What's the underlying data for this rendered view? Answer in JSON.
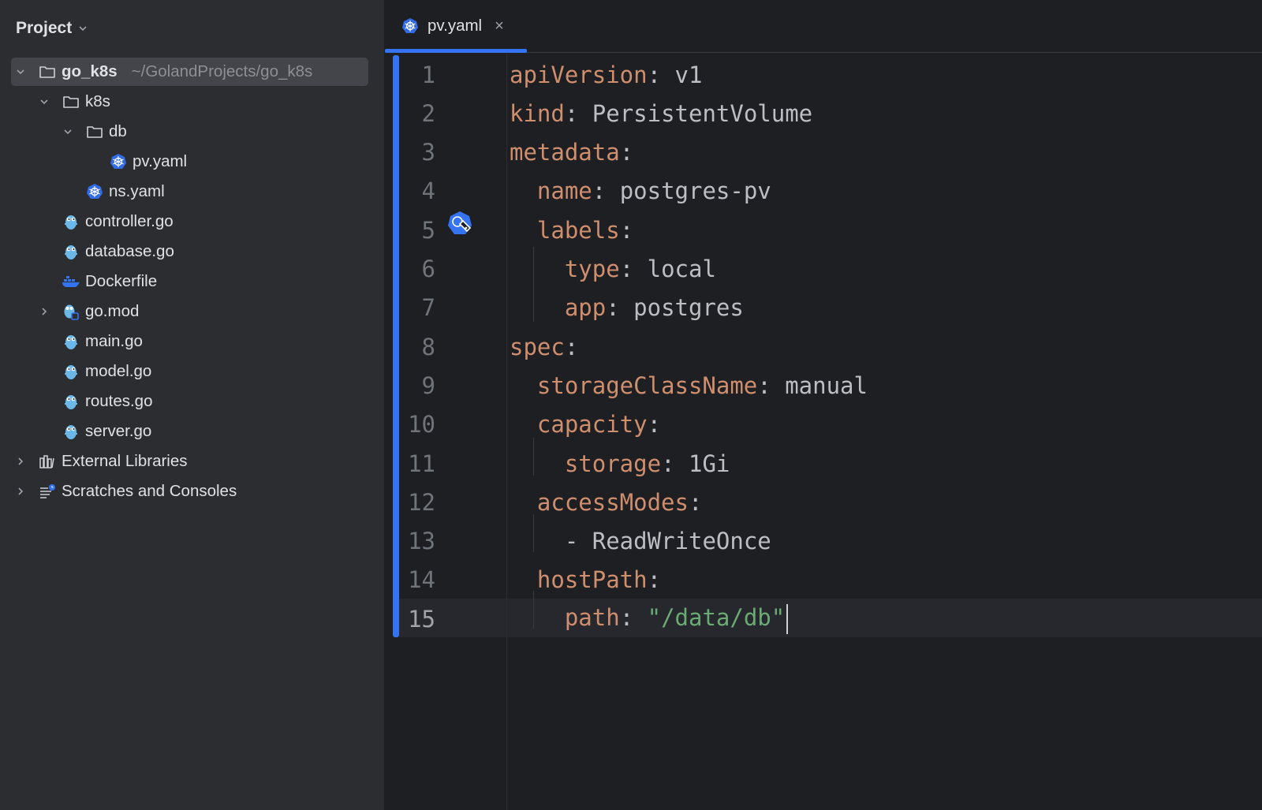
{
  "sidebar": {
    "title": "Project",
    "tree": [
      {
        "label": "go_k8s",
        "path": "~/GolandProjects/go_k8s",
        "icon": "folder-icon"
      },
      {
        "label": "k8s",
        "icon": "folder-icon"
      },
      {
        "label": "db",
        "icon": "folder-icon"
      },
      {
        "label": "pv.yaml",
        "icon": "kubernetes-icon"
      },
      {
        "label": "ns.yaml",
        "icon": "kubernetes-icon"
      },
      {
        "label": "controller.go",
        "icon": "gopher-icon"
      },
      {
        "label": "database.go",
        "icon": "gopher-icon"
      },
      {
        "label": "Dockerfile",
        "icon": "docker-icon"
      },
      {
        "label": "go.mod",
        "icon": "gomod-icon"
      },
      {
        "label": "main.go",
        "icon": "gopher-icon"
      },
      {
        "label": "model.go",
        "icon": "gopher-icon"
      },
      {
        "label": "routes.go",
        "icon": "gopher-icon"
      },
      {
        "label": "server.go",
        "icon": "gopher-icon"
      },
      {
        "label": "External Libraries",
        "icon": "libraries-icon"
      },
      {
        "label": "Scratches and Consoles",
        "icon": "scratches-icon"
      }
    ]
  },
  "editor": {
    "tab": {
      "label": "pv.yaml",
      "close": "×"
    },
    "lines": [
      {
        "n": "1",
        "key": "apiVersion",
        "colon": ":",
        "val": " v1"
      },
      {
        "n": "2",
        "key": "kind",
        "colon": ":",
        "val": " PersistentVolume"
      },
      {
        "n": "3",
        "key": "metadata",
        "colon": ":",
        "val": ""
      },
      {
        "n": "4",
        "key": "  name",
        "colon": ":",
        "val": " postgres-pv"
      },
      {
        "n": "5",
        "key": "  labels",
        "colon": ":",
        "val": ""
      },
      {
        "n": "6",
        "key": "    type",
        "colon": ":",
        "val": " local"
      },
      {
        "n": "7",
        "key": "    app",
        "colon": ":",
        "val": " postgres"
      },
      {
        "n": "8",
        "key": "spec",
        "colon": ":",
        "val": ""
      },
      {
        "n": "9",
        "key": "  storageClassName",
        "colon": ":",
        "val": " manual"
      },
      {
        "n": "10",
        "key": "  capacity",
        "colon": ":",
        "val": ""
      },
      {
        "n": "11",
        "key": "    storage",
        "colon": ":",
        "val": " 1Gi"
      },
      {
        "n": "12",
        "key": "  accessModes",
        "colon": ":",
        "val": ""
      },
      {
        "n": "13",
        "key": "    ",
        "colon": "- ",
        "val": "ReadWriteOnce"
      },
      {
        "n": "14",
        "key": "  hostPath",
        "colon": ":",
        "val": ""
      },
      {
        "n": "15",
        "key": "    path",
        "colon": ": ",
        "val": "\"/data/db\""
      }
    ]
  },
  "colors": {
    "accent": "#3574f0",
    "key": "#cf8e6d",
    "string": "#6aab73",
    "sidebar_bg": "#2b2d30",
    "editor_bg": "#1e1f22"
  }
}
